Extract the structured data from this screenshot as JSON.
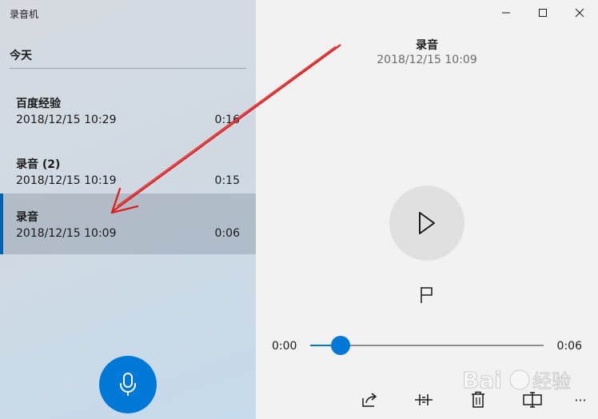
{
  "app": {
    "title": "录音机"
  },
  "left": {
    "section_header": "今天",
    "recordings": [
      {
        "name": "百度经验",
        "date": "2018/12/15 10:29",
        "duration": "0:16",
        "selected": false
      },
      {
        "name": "录音 (2)",
        "date": "2018/12/15 10:19",
        "duration": "0:15",
        "selected": false
      },
      {
        "name": "录音",
        "date": "2018/12/15 10:09",
        "duration": "0:06",
        "selected": true
      }
    ],
    "record_icon": "microphone-icon"
  },
  "player": {
    "title": "录音",
    "date": "2018/12/15 10:09",
    "current_time": "0:00",
    "total_time": "0:06",
    "progress": 0.13,
    "play_icon": "play-icon",
    "marker_icon": "flag-icon"
  },
  "toolbar": {
    "icons": [
      "share-icon",
      "trim-icon",
      "delete-icon",
      "rename-icon",
      "more-icon"
    ],
    "more_label": "···"
  },
  "window_controls": [
    "minimize-icon",
    "maximize-icon",
    "close-icon"
  ],
  "watermark": {
    "text": "Bai经验"
  },
  "colors": {
    "accent": "#0078d7",
    "annotation": "#e02020"
  }
}
